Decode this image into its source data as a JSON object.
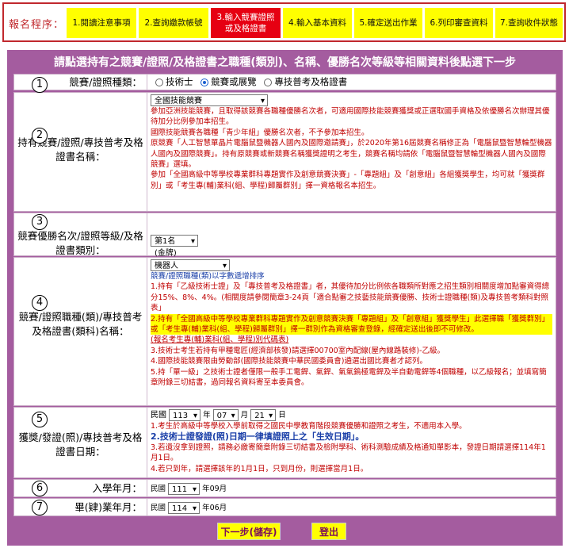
{
  "progress": {
    "title": "報名程序：",
    "steps": [
      "1.閱讀注意事項",
      "2.查詢繳款帳號",
      "3.輸入競賽證照\n或及格證書",
      "4.輸入基本資料",
      "5.確定送出作業",
      "6.列印審查資料",
      "7.查詢收件狀態"
    ],
    "active_index": 2
  },
  "header": {
    "title": "請點選持有之競賽/證照/及格證書之職種(類別)、名稱、優勝名次等級等相關資料後點選下一步"
  },
  "row1": {
    "num": "1",
    "label": "競賽/證照種類：",
    "options": [
      "技術士",
      "競賽或展覽",
      "專技普考及格證書"
    ],
    "selected": "競賽或展覽"
  },
  "row2": {
    "num": "2",
    "label": "持有競賽/證照/專技普考及格證書名稱：",
    "select": "全國技能競賽",
    "notes": [
      "參加亞洲技能競賽，且取得該競賽各職種優勝名次者，可適用國際技能競賽獲獎或正選取國手資格及依優勝名次辦理其優待加分比例參加本招生。",
      "國際技能競賽各職種「青少年組」優勝名次者，不予參加本招生。",
      "原競賽「人工智慧單晶片電腦鼠暨機器人國內及國際邀請賽」，於2020年第16屆競賽名稱修正為「電腦鼠暨智慧輪型機器人國內及國際競賽」。持有原競賽或新競賽名稱獲獎證明之考生，競賽名稱均請依「電腦鼠暨智慧輪型機器人國內及國際競賽」選填。",
      "參加「全國高級中等學校專業群科專題實作及創意競賽決賽」-「專題組」及「創意組」各組獲獎學生，均可就「獲獎群別」或「考生專(輔)業科(組、學程)歸屬群別」擇一資格報名本招生。"
    ]
  },
  "row3": {
    "num": "3",
    "label": "競賽優勝名次/證照等級/及格證書類別：",
    "select": "第1名(金牌)"
  },
  "row4": {
    "num": "4",
    "label": "競賽/證照職種(類)/專技普考及格證書(類科)名稱：",
    "select": "機器人",
    "sort_note": "競賽/證照職種(類)以字數遞增排序",
    "notes": [
      "1.持有「乙級技術士證」及「專技普考及格證書」者，其優待加分比例依各職類所對應之招生類別相關度增加點審資得總分15%、8%、4%。(相關度請參閱簡章3-24頁「適合點審之技藝技能競賽優勝、技術士證職種(類)及專技普考類科對照表」",
      "2.持有「全國高級中等學校專業群科專題實作及創意競賽決賽「專題組」及「創意組」獲獎學生」此選擇職「獲獎群別」或「考生專(輔)業科(組、學程)歸屬群別」擇一群別作為資格審查登錄，經確定送出後即不可修改。",
      "(報名考生專(輔)業科(組、學程)別代碼表)",
      "3.技術士考生若持有甲種電匠(經濟部核發)請選擇00700室內配線(屋內線路裝修)-乙級。",
      "4.國際技能競賽限由勞動部(國際技能競賽中華民國委員會)遴選出國比賽者才認列。",
      "5.持「單一級」之技術士證者僅限一般手工電銲、氣銲、氣氣鎢極電銲及半自動電銲等4個職種，以乙級報名；並填寫簡章附錄三切結書，過同報名資料寄至本委員會。"
    ]
  },
  "row5": {
    "num": "5",
    "label": "獲獎/發證(照)/專技普考及格證書日期：",
    "era": "民國",
    "year": "113",
    "month": "07",
    "day": "21",
    "u_year": "年",
    "u_month": "月",
    "u_day": "日",
    "notes": [
      "1.考生於高級中等學校入學前取得之國民中學教育階段競賽優勝和證照之考生，不適用本入學。",
      "2.技術士證發證(照)日期一律填證照上之「生效日期」。",
      "3.若遺沒拿到證照，請務必繳寄簡章附錄三切結書及檢附學科、術科測驗成績及格通知單影本，發證日期請選擇114年1月1日。",
      "4.若只到年，請選擇該年的1月1日，只到月份，則選擇當月1日。"
    ]
  },
  "row6": {
    "num": "6",
    "label": "入學年月：",
    "era": "民國",
    "year": "111",
    "suffix": "年09月"
  },
  "row7": {
    "num": "7",
    "label": "畢(肄)業年月：",
    "era": "民國",
    "year": "114",
    "suffix": "年06月"
  },
  "buttons": {
    "next": "下一步(儲存)",
    "logout": "登出"
  }
}
